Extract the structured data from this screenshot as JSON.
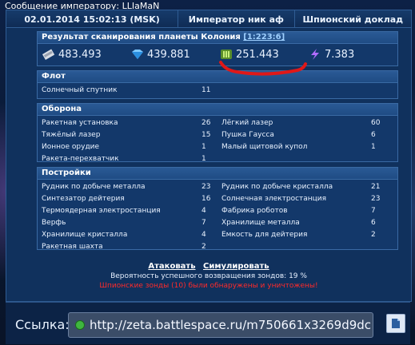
{
  "top": {
    "title": "Сообщение императору: LLIaMaN"
  },
  "header": {
    "datetime": "02.01.2014 15:02:13 (MSK)",
    "player": "Император ник аф",
    "report": "Шпионский доклад"
  },
  "resources": {
    "title": "Результат сканирования планеты Колония",
    "coords": "[1:223:6]",
    "metal": "483.493",
    "crystal": "439.881",
    "deuterium": "251.443",
    "energy": "7.383"
  },
  "fleet": {
    "title": "Флот",
    "rows": [
      {
        "name": "Солнечный спутник",
        "count": "11"
      }
    ]
  },
  "defense": {
    "title": "Оборона",
    "rows": [
      {
        "a": "Ракетная установка",
        "an": "26",
        "b": "Лёгкий лазер",
        "bn": "60"
      },
      {
        "a": "Тяжёлый лазер",
        "an": "15",
        "b": "Пушка Гаусса",
        "bn": "6"
      },
      {
        "a": "Ионное орудие",
        "an": "1",
        "b": "Малый щитовой купол",
        "bn": "1"
      },
      {
        "a": "Ракета-перехватчик",
        "an": "1",
        "b": "",
        "bn": ""
      }
    ]
  },
  "buildings": {
    "title": "Постройки",
    "rows": [
      {
        "a": "Рудник по добыче металла",
        "an": "23",
        "b": "Рудник по добыче кристалла",
        "bn": "21"
      },
      {
        "a": "Синтезатор дейтерия",
        "an": "16",
        "b": "Солнечная электростанция",
        "bn": "23"
      },
      {
        "a": "Термоядерная электростанция",
        "an": "4",
        "b": "Фабрика роботов",
        "bn": "7"
      },
      {
        "a": "Верфь",
        "an": "7",
        "b": "Хранилище металла",
        "bn": "6"
      },
      {
        "a": "Хранилище кристалла",
        "an": "4",
        "b": "Емкость для дейтерия",
        "bn": "2"
      },
      {
        "a": "Ракетная шахта",
        "an": "2",
        "b": "",
        "bn": ""
      }
    ]
  },
  "actions": {
    "attack": "Атаковать",
    "simulate": "Симулировать"
  },
  "probability": "Вероятность успешного возвращения зондов: 19 %",
  "warning": "Шпионские зонды (10) были обнаружены и уничтожены!",
  "link": {
    "label": "Ссылка:",
    "url": "http://zeta.battlespace.ru/m750661x3269d9dc"
  },
  "colors": {
    "accent": "#2a5a95",
    "warning": "#ff2a2a",
    "mark": "#e01818"
  }
}
